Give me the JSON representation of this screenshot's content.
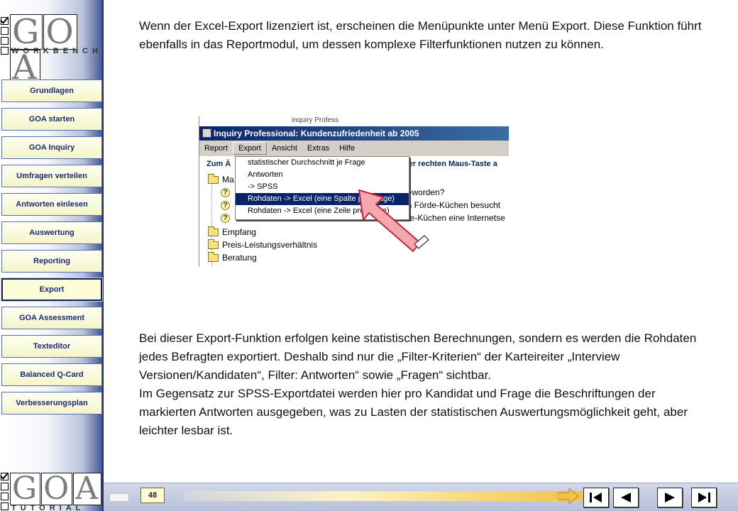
{
  "sidebar": {
    "logo_top": {
      "letters": [
        "G",
        "O",
        "A"
      ],
      "subtitle": "WorkBench"
    },
    "logo_bottom": {
      "letters": [
        "G",
        "O",
        "A"
      ],
      "subtitle": "Tutorial"
    },
    "nav_items": [
      {
        "label": "Grundlagen"
      },
      {
        "label": "GOA starten"
      },
      {
        "label": "GOA Inquiry"
      },
      {
        "label": "Umfragen verteilen"
      },
      {
        "label": "Antworten einlesen"
      },
      {
        "label": "Auswertung"
      },
      {
        "label": "Reporting"
      },
      {
        "label": "Export",
        "active": true
      },
      {
        "label": "GOA Assessment"
      },
      {
        "label": "Texteditor"
      },
      {
        "label": "Balanced Q-Card"
      },
      {
        "label": "Verbesserungsplan"
      }
    ]
  },
  "content": {
    "paragraph_top": "Wenn der Excel-Export lizenziert ist, erscheinen die Menüpunkte unter Menü Export. Diese Funktion führt ebenfalls in das Reportmodul, um dessen komplexe Filterfunktionen nutzen zu können.",
    "paragraph_bottom_1": "Bei dieser Export-Funktion erfolgen keine statistischen Berechnungen, sondern es werden die Rohdaten jedes Befragten exportiert. Deshalb sind nur die „Filter-Kriterien“ der Karteireiter „Interview Versionen/Kandidaten“, Filter: Antworten“ sowie „Fragen“ sichtbar.",
    "paragraph_bottom_2": "Im Gegensatz zur SPSS-Exportdatei werden hier pro Kandidat und Frage die Beschriftungen der markierten Antworten ausgegeben, was zu Lasten der statistischen Auswertungsmöglichkeit geht, aber leichter lesbar ist."
  },
  "screenshot": {
    "cut_text": "inquiry Profess",
    "title": "Inquiry Professional: Kundenzufriedenheit ab 2005",
    "menus": [
      "Report",
      "Export",
      "Ansicht",
      "Extras",
      "Hilfe"
    ],
    "open_menu": "Export",
    "toolrow_left": "Zum Ä",
    "toolrow_right": "der rechten Maus-Taste a",
    "dropdown_items": [
      {
        "label": "statistischer Durchschnitt je Frage",
        "selected": false
      },
      {
        "label": "Antworten",
        "selected": false
      },
      {
        "label": "-> SPSS",
        "selected": false
      },
      {
        "label": "Rohdaten -> Excel (eine Spalte pro Frage)",
        "selected": true
      },
      {
        "label": "Rohdaten -> Excel (eine Zeile pro Frage)",
        "selected": false
      }
    ],
    "tree_fragments": {
      "row1_right": "geworden?",
      "row2_right": "on Förde-Küchen besucht",
      "row3_right": "rde-Küchen eine Internetse"
    },
    "tree_folders": [
      "Empfang",
      "Preis-Leistungsverhältnis",
      "Beratung"
    ]
  },
  "footer": {
    "page_number": "48"
  },
  "colors": {
    "nav_border": "#5a6fa8",
    "nav_text": "#1b2b70",
    "nav_bg": "#f4f5c9",
    "titlebar": "#0a246a",
    "pointer": "#f4a7ae"
  }
}
